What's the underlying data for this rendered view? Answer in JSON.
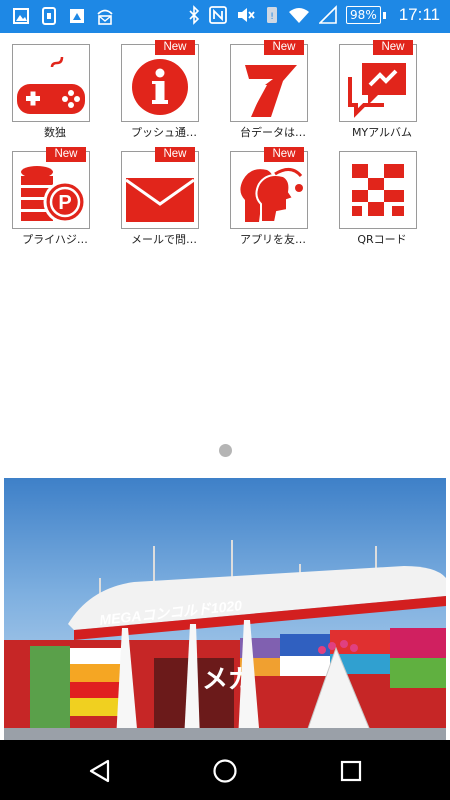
{
  "status_bar": {
    "battery": "98%",
    "time": "17:11",
    "notification_icons": [
      "image-icon",
      "download-icon",
      "shield-image-icon",
      "wifi-mail-icon"
    ],
    "system_icons": [
      "bluetooth-icon",
      "nfc-icon",
      "mute-icon",
      "vibrate-icon",
      "wifi-icon",
      "signal-icon",
      "battery-icon"
    ]
  },
  "apps": [
    {
      "label": "数独",
      "new": false,
      "icon": "gamepad-icon"
    },
    {
      "label": "プッシュ通…",
      "new": true,
      "icon": "info-icon"
    },
    {
      "label": "台データは…",
      "new": true,
      "icon": "seven-icon"
    },
    {
      "label": "MYアルバム",
      "new": true,
      "icon": "chat-icon"
    },
    {
      "label": "プライハジ…",
      "new": true,
      "icon": "coins-icon"
    },
    {
      "label": "メールで問…",
      "new": true,
      "icon": "envelope-icon"
    },
    {
      "label": "アプリを友…",
      "new": true,
      "icon": "share-people-icon"
    },
    {
      "label": "QRコード",
      "new": false,
      "icon": "qr-code-icon"
    }
  ],
  "badge_text": "New",
  "banner": {
    "sign_text": "MEGAコンコルド1020",
    "storefront_text": "メガ"
  },
  "colors": {
    "brand_red": "#e1251b",
    "status_bar": "#1e88e5",
    "nav_bar": "#000000"
  },
  "navigation": [
    "back-icon",
    "home-icon",
    "recents-icon"
  ]
}
